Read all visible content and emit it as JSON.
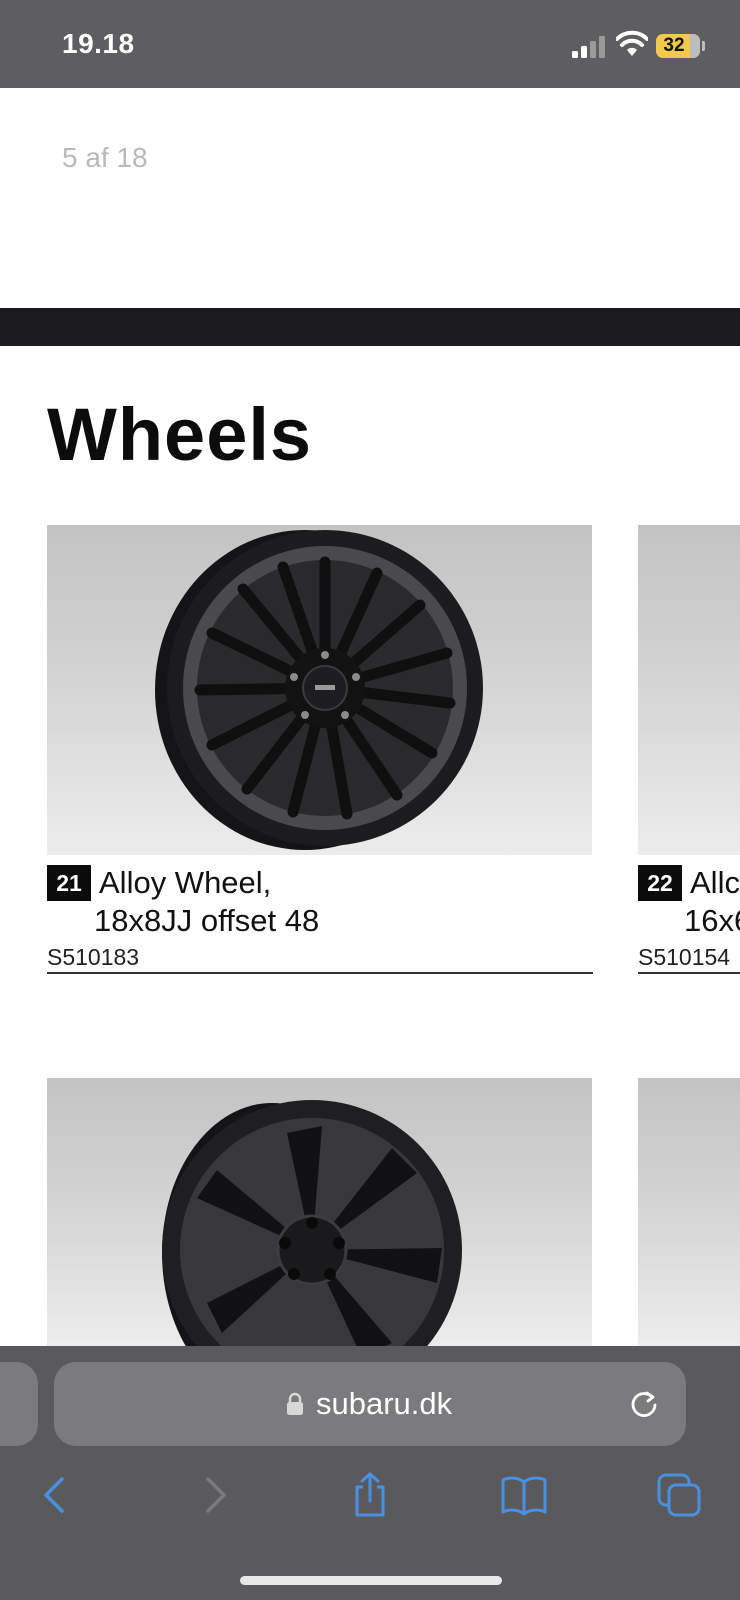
{
  "status_bar": {
    "time": "19.18",
    "battery_level": "32",
    "icons": [
      "signal-icon",
      "wifi-icon",
      "battery-icon"
    ]
  },
  "viewer": {
    "page_counter": "5 af 18"
  },
  "section": {
    "title": "Wheels"
  },
  "products": [
    {
      "number": "21",
      "name_line1": "Alloy Wheel,",
      "name_line2": "18x8JJ offset 48",
      "sku": "S510183"
    },
    {
      "number": "22",
      "name_line1": "Allc",
      "name_line2": "16x6",
      "sku": "S510154"
    }
  ],
  "browser": {
    "url": "subaru.dk",
    "toolbar_icons": [
      "back-icon",
      "forward-icon",
      "share-icon",
      "bookmarks-icon",
      "tabs-icon"
    ]
  },
  "colors": {
    "status_bar_bg": "#5e5e60",
    "battery_accent": "#f2c94c",
    "toolbar_icon": "#4a90e2"
  }
}
